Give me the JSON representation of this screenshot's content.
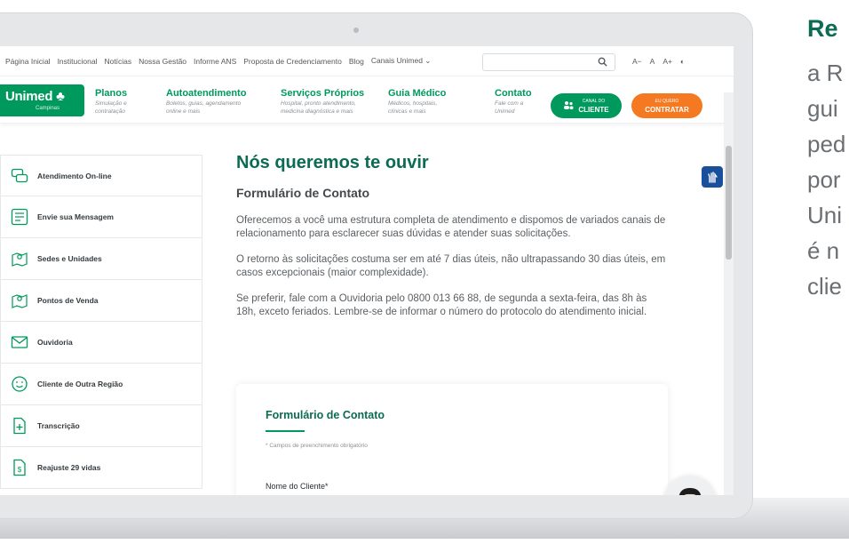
{
  "side_copy": {
    "heading": "Re",
    "lines": [
      "a R",
      "gui",
      "ped",
      "por",
      "Uni",
      "é n",
      "clie"
    ]
  },
  "topnav": {
    "links": [
      "Página Inicial",
      "Institucional",
      "Notícias",
      "Nossa Gestão",
      "Informe ANS",
      "Proposta de Credenciamento",
      "Blog",
      "Canais Unimed ⌄"
    ],
    "search_placeholder": "",
    "a11y": [
      "A−",
      "A",
      "A+",
      "◐"
    ]
  },
  "header": {
    "logo_text": "Unimed",
    "logo_symbol": "♣",
    "logo_sub": "Campinas",
    "menu": [
      {
        "title": "Planos",
        "sub": "Simulação e\ncontratação"
      },
      {
        "title": "Autoatendimento",
        "sub": "Boletos, guias, agendamento\nonline e mais"
      },
      {
        "title": "Serviços Próprios",
        "sub": "Hospital, pronto atendimento,\nmedicina diagnóstica e mais"
      },
      {
        "title": "Guia Médico",
        "sub": "Médicos, hospitais,\nclínicas e mais"
      },
      {
        "title": "Contato",
        "sub": "Fale com a\nUnimed"
      }
    ],
    "canal_small": "CANAL DO",
    "canal_big": "CLIENTE",
    "contratar_small": "EU QUERO",
    "contratar_big": "CONTRATAR"
  },
  "sidebar": {
    "items": [
      {
        "label": "Atendimento On-line",
        "icon": "chat-icon"
      },
      {
        "label": "Envie sua Mensagem",
        "icon": "message-form-icon"
      },
      {
        "label": "Sedes e Unidades",
        "icon": "map-pin-icon"
      },
      {
        "label": "Pontos de Venda",
        "icon": "map-pin-icon"
      },
      {
        "label": "Ouvidoria",
        "icon": "envelope-icon"
      },
      {
        "label": "Cliente de Outra Região",
        "icon": "smile-icon"
      },
      {
        "label": "Transcrição",
        "icon": "document-plus-icon"
      },
      {
        "label": "Reajuste 29 vidas",
        "icon": "document-dollar-icon"
      }
    ]
  },
  "main": {
    "title": "Nós queremos te ouvir",
    "subtitle": "Formulário de Contato",
    "paragraphs": [
      "Oferecemos a você uma estrutura completa de atendimento e dispomos de variados canais de relacionamento para esclarecer suas dúvidas e atender suas solicitações.",
      "O retorno às solicitações costuma ser em até 7 dias úteis, não ultrapassando 30 dias úteis, em casos excepcionais (maior complexidade).",
      "Se preferir, fale com a Ouvidoria pelo 0800 013 66 88, de segunda a sexta-feira, das 8h às 18h, exceto feriados. Lembre-se de informar o número do protocolo do atendimento inicial."
    ]
  },
  "form": {
    "title": "Formulário de Contato",
    "note": "* Campos de preenchimento obrigatório",
    "field_label": "Nome do Cliente*"
  },
  "colors": {
    "brand_green": "#00995d",
    "title_green": "#0b6b53",
    "orange": "#f47920",
    "libras_blue": "#1a4f9c"
  }
}
